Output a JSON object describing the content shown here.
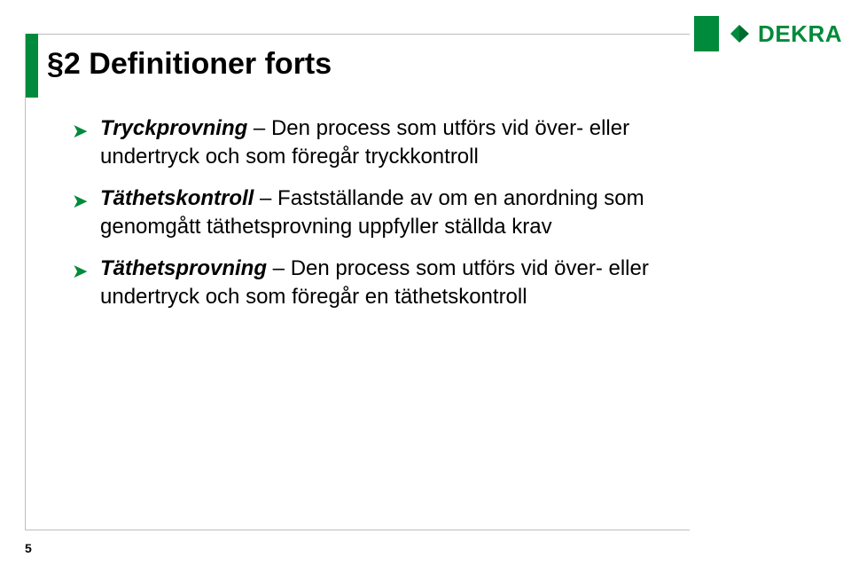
{
  "brand": {
    "name": "DEKRA",
    "color": "#008A3B"
  },
  "title": "§2 Definitioner forts",
  "bullets": [
    {
      "term": "Tryckprovning",
      "rest": " – Den process som utförs vid över- eller undertryck och som föregår tryckkontroll"
    },
    {
      "term": "Täthetskontroll",
      "rest": " – Fastställande av om en anordning som genomgått täthetsprovning uppfyller ställda krav"
    },
    {
      "term": "Täthetsprovning",
      "rest": " – Den process som utförs vid över- eller undertryck och som föregår en täthetskontroll"
    }
  ],
  "pageNumber": "5"
}
